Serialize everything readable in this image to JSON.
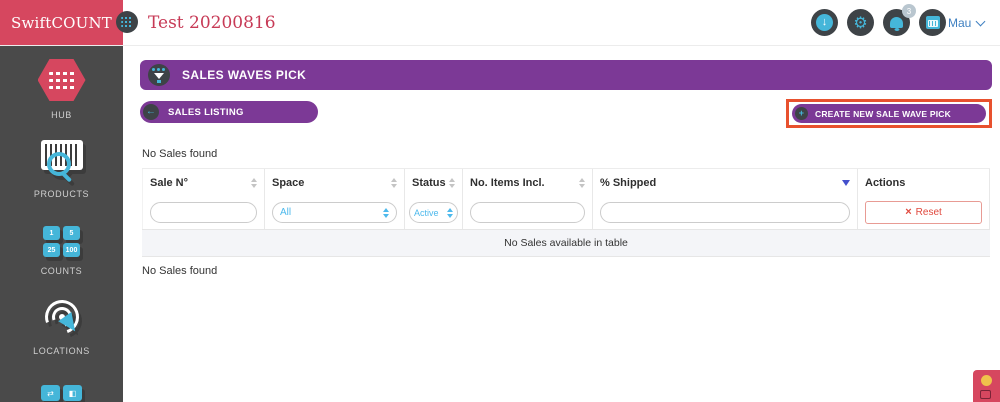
{
  "header": {
    "brand": "SwiftCOUNT",
    "page_ref": "Test 20200816",
    "user": "Mau",
    "notification_count": "3"
  },
  "icons": {
    "download_glyph": "↓",
    "gear_glyph": "⚙",
    "back_arrow_glyph": "←",
    "plus_glyph": "+",
    "reset_x_glyph": "×"
  },
  "sidebar": {
    "items": [
      {
        "label": "HUB"
      },
      {
        "label": "PRODUCTS"
      },
      {
        "label": "COUNTS",
        "tiles": [
          "1",
          "5",
          "25",
          "100"
        ]
      },
      {
        "label": "LOCATIONS"
      }
    ]
  },
  "main": {
    "section_title": "SALES WAVES PICK",
    "sales_listing_label": "SALES LISTING",
    "create_label": "CREATE NEW SALE WAVE PICK",
    "no_sales_top": "No Sales found",
    "no_sales_bottom": "No Sales found",
    "table": {
      "columns": [
        {
          "label": "Sale N°"
        },
        {
          "label": "Space",
          "filter_value": "All"
        },
        {
          "label": "Status",
          "filter_value": "Active"
        },
        {
          "label": "No. Items Incl."
        },
        {
          "label": "% Shipped"
        },
        {
          "label": "Actions"
        }
      ],
      "reset_label": "Reset",
      "empty_message": "No Sales available in table"
    }
  },
  "colors": {
    "crimson": "#d6475f",
    "purple": "#7c3996",
    "sidebar_bg": "#4a4a4a",
    "icon_blue": "#45b6d9",
    "link_blue": "#3f80c1",
    "highlight_orange": "#e8512e",
    "reset_red": "#e0483d",
    "sort_active_blue": "#4450cc"
  }
}
